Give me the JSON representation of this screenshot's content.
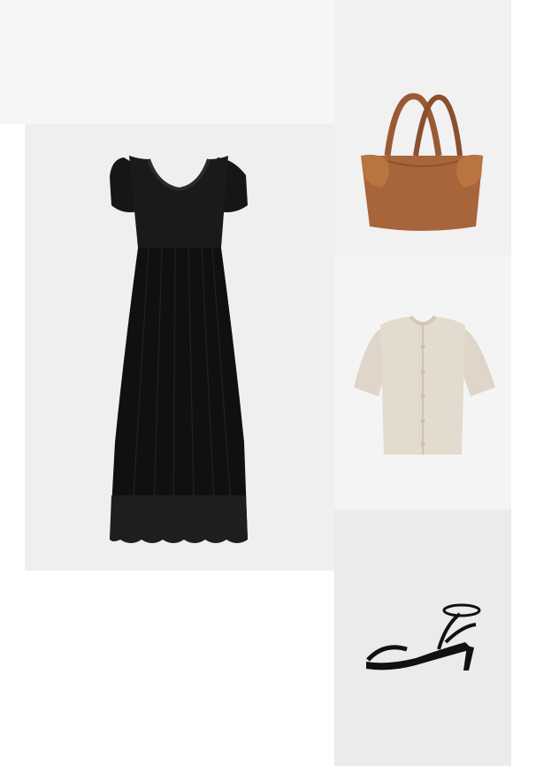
{
  "outfit": {
    "products": [
      {
        "id": "dress",
        "icon": "black-crochet-maxi-dress-image",
        "color": "#141414"
      },
      {
        "id": "bag",
        "icon": "brown-leather-tote-bag-image",
        "color": "#a8643a"
      },
      {
        "id": "cardigan",
        "icon": "beige-knit-short-sleeve-cardigan-image",
        "color": "#e2d8cb"
      },
      {
        "id": "sandals",
        "icon": "black-kitten-heel-sandals-image",
        "color": "#111111"
      }
    ]
  }
}
